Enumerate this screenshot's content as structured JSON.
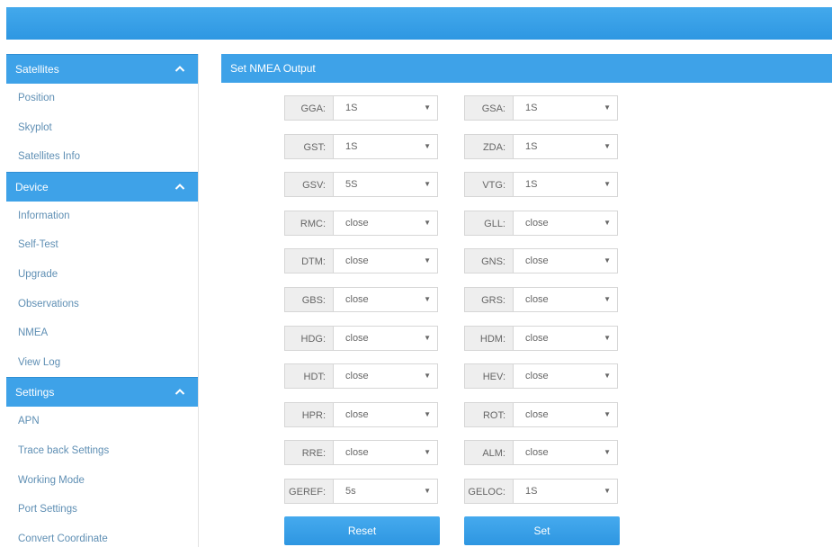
{
  "sidebar": {
    "sections": [
      {
        "title": "Satellites",
        "items": [
          "Position",
          "Skyplot",
          "Satellites Info"
        ]
      },
      {
        "title": "Device",
        "items": [
          "Information",
          "Self-Test",
          "Upgrade",
          "Observations",
          "NMEA",
          "View Log"
        ]
      },
      {
        "title": "Settings",
        "items": [
          "APN",
          "Trace back Settings",
          "Working Mode",
          "Port Settings",
          "Convert Coordinate"
        ]
      }
    ]
  },
  "main": {
    "title": "Set NMEA Output",
    "rows": [
      [
        {
          "label": "GGA:",
          "value": "1S"
        },
        {
          "label": "GSA:",
          "value": "1S"
        }
      ],
      [
        {
          "label": "GST:",
          "value": "1S"
        },
        {
          "label": "ZDA:",
          "value": "1S"
        }
      ],
      [
        {
          "label": "GSV:",
          "value": "5S"
        },
        {
          "label": "VTG:",
          "value": "1S"
        }
      ],
      [
        {
          "label": "RMC:",
          "value": "close"
        },
        {
          "label": "GLL:",
          "value": "close"
        }
      ],
      [
        {
          "label": "DTM:",
          "value": "close"
        },
        {
          "label": "GNS:",
          "value": "close"
        }
      ],
      [
        {
          "label": "GBS:",
          "value": "close"
        },
        {
          "label": "GRS:",
          "value": "close"
        }
      ],
      [
        {
          "label": "HDG:",
          "value": "close"
        },
        {
          "label": "HDM:",
          "value": "close"
        }
      ],
      [
        {
          "label": "HDT:",
          "value": "close"
        },
        {
          "label": "HEV:",
          "value": "close"
        }
      ],
      [
        {
          "label": "HPR:",
          "value": "close"
        },
        {
          "label": "ROT:",
          "value": "close"
        }
      ],
      [
        {
          "label": "RRE:",
          "value": "close"
        },
        {
          "label": "ALM:",
          "value": "close"
        }
      ],
      [
        {
          "label": "GEREF:",
          "value": "5s"
        },
        {
          "label": "GELOC:",
          "value": "1S"
        }
      ]
    ],
    "reset_label": "Reset",
    "set_label": "Set"
  },
  "colors": {
    "accent": "#3ea2e8",
    "nav_text": "#5f8fb4",
    "label_bg": "#eeeeee"
  },
  "icons": {
    "section_toggle": "chevron-up-icon",
    "select_arrow": "caret-down-icon"
  }
}
